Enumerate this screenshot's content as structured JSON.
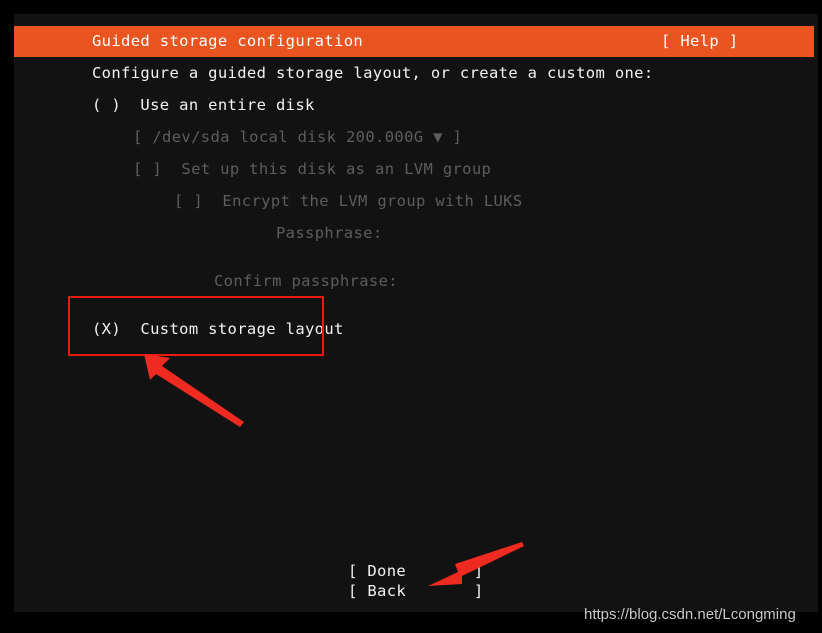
{
  "window": {
    "background_color": "#121212",
    "outer_background_color": "#000000"
  },
  "header": {
    "title": "Guided storage configuration",
    "help_label": "[ Help ]",
    "accent_color": "#e95420",
    "text_color": "#ffffff"
  },
  "main": {
    "prompt": "Configure a guided storage layout, or create a custom one:",
    "options": [
      {
        "id": "use-entire-disk",
        "radio": "( )",
        "label": "Use an entire disk",
        "selected": false,
        "enabled": true,
        "text": "( )  Use an entire disk"
      },
      {
        "id": "custom-storage-layout",
        "radio": "(X)",
        "label": "Custom storage layout",
        "selected": true,
        "enabled": true,
        "text": "(X)  Custom storage layout"
      }
    ],
    "disk_selector": {
      "text": "[ /dev/sda local disk 200.000G ▼ ]",
      "device": "/dev/sda",
      "description": "local disk",
      "size": "200.000G",
      "chevron": "▼",
      "enabled": false
    },
    "lvm_checkbox": {
      "text": "[ ]  Set up this disk as an LVM group",
      "checkbox": "[ ]",
      "label": "Set up this disk as an LVM group",
      "checked": false,
      "enabled": false
    },
    "luks_checkbox": {
      "text": "[ ]  Encrypt the LVM group with LUKS",
      "checkbox": "[ ]",
      "label": "Encrypt the LVM group with LUKS",
      "checked": false,
      "enabled": false
    },
    "passphrase_field": {
      "label": "Passphrase:",
      "value": "",
      "enabled": false
    },
    "confirm_passphrase_field": {
      "label": "Confirm passphrase:",
      "value": "",
      "enabled": false
    },
    "dim_text_color": "#5d5d5d",
    "text_color": "#f2f2f2"
  },
  "footer": {
    "buttons": [
      {
        "id": "done",
        "text": "[ Done       ]",
        "label": "Done"
      },
      {
        "id": "back",
        "text": "[ Back       ]",
        "label": "Back"
      }
    ]
  },
  "annotations": {
    "color": "#e81b13",
    "highlight_target": "Custom storage layout",
    "arrows": [
      {
        "id": "arrow-to-custom-storage-layout",
        "points_to": "Custom storage layout"
      },
      {
        "id": "arrow-to-done-button",
        "points_to": "Done"
      }
    ]
  },
  "watermark": {
    "text": "https://blog.csdn.net/Lcongming"
  }
}
